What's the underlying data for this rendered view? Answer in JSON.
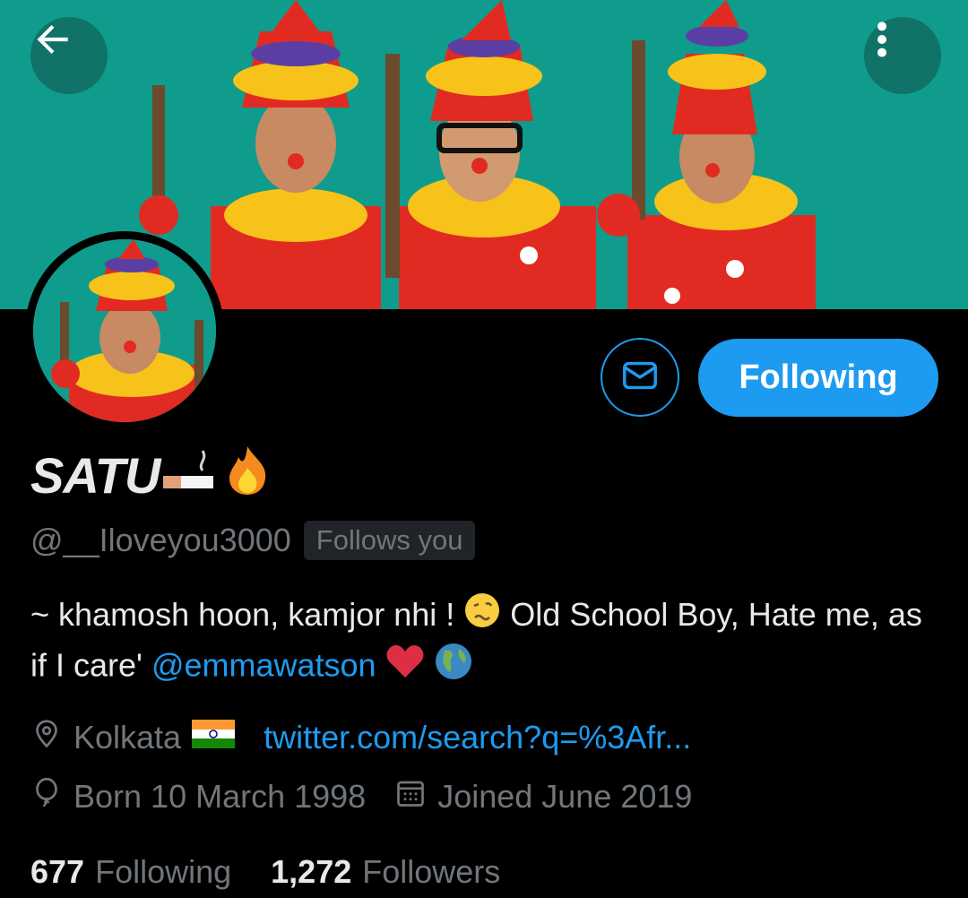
{
  "profile": {
    "display_name": "SATU",
    "handle": "@__Iloveyou3000",
    "follows_you": "Follows you",
    "bio": {
      "text_1": "~ khamosh hoon, kamjor nhi !",
      "text_2": "Old School Boy, Hate me, as if I care'",
      "mention": "@emmawatson"
    },
    "location": "Kolkata",
    "website": "twitter.com/search?q=%3Afr...",
    "birthday": "Born 10 March 1998",
    "joined": "Joined June 2019",
    "following_count": "677",
    "following_label": "Following",
    "followers_count": "1,272",
    "followers_label": "Followers"
  },
  "actions": {
    "follow_button": "Following"
  },
  "icons": {
    "back": "arrow-left-icon",
    "more": "more-vertical-icon",
    "message": "envelope-icon",
    "location": "location-pin-icon",
    "birthday": "balloon-icon",
    "joined": "calendar-icon"
  },
  "colors": {
    "accent": "#1d9bf0",
    "banner": "#0f9c8c",
    "muted_text": "#71767b",
    "background": "#000000"
  }
}
